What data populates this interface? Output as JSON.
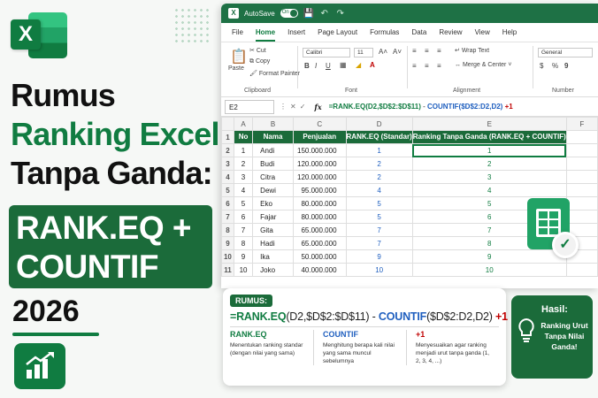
{
  "banner": {
    "title_line1": "Rumus",
    "title_line2": "Ranking Excel",
    "title_line3": "Tanpa Ganda:",
    "box_line1": "RANK.EQ +",
    "box_line2": "COUNTIF",
    "year": "2026"
  },
  "window": {
    "autosave": "AutoSave",
    "toggle": "On",
    "tabs": [
      "File",
      "Home",
      "Insert",
      "Page Layout",
      "Formulas",
      "Data",
      "Review",
      "View",
      "Help"
    ],
    "active_tab": "Home",
    "ribbon": {
      "paste": "Paste",
      "cut": "Cut",
      "copy": "Copy",
      "format_painter": "Format Painter",
      "clipboard": "Clipboard",
      "font_name": "Calibri",
      "font_size": "11",
      "font_group": "Font",
      "wrap_text": "Wrap Text",
      "merge_center": "Merge & Center",
      "alignment": "Alignment",
      "number_format": "General",
      "number": "Number"
    },
    "name_box": "E2",
    "fx": "fx",
    "formula": {
      "part1": "=RANK.EQ(D2,$D$2:$D$11)",
      "dash": " - ",
      "part2": "COUNTIF($D$2:D2,D2)",
      "part3": " +1"
    }
  },
  "sheet": {
    "columns": [
      "A",
      "B",
      "C",
      "D",
      "E",
      "F"
    ],
    "headers": {
      "no": "No",
      "nama": "Nama",
      "penjualan": "Penjualan",
      "rank_std": "RANK.EQ (Standar)",
      "rank_unique": "Ranking Tanpa Ganda (RANK.EQ + COUNTIF)"
    },
    "rows": [
      {
        "row": "2",
        "no": "1",
        "nama": "Andi",
        "penjualan": "150.000.000",
        "rank": "1",
        "unique": "1"
      },
      {
        "row": "3",
        "no": "2",
        "nama": "Budi",
        "penjualan": "120.000.000",
        "rank": "2",
        "unique": "2"
      },
      {
        "row": "4",
        "no": "3",
        "nama": "Citra",
        "penjualan": "120.000.000",
        "rank": "2",
        "unique": "3"
      },
      {
        "row": "5",
        "no": "4",
        "nama": "Dewi",
        "penjualan": "95.000.000",
        "rank": "4",
        "unique": "4"
      },
      {
        "row": "6",
        "no": "5",
        "nama": "Eko",
        "penjualan": "80.000.000",
        "rank": "5",
        "unique": "5"
      },
      {
        "row": "7",
        "no": "6",
        "nama": "Fajar",
        "penjualan": "80.000.000",
        "rank": "5",
        "unique": "6"
      },
      {
        "row": "8",
        "no": "7",
        "nama": "Gita",
        "penjualan": "65.000.000",
        "rank": "7",
        "unique": "7"
      },
      {
        "row": "9",
        "no": "8",
        "nama": "Hadi",
        "penjualan": "65.000.000",
        "rank": "7",
        "unique": "8"
      },
      {
        "row": "10",
        "no": "9",
        "nama": "Ika",
        "penjualan": "50.000.000",
        "rank": "9",
        "unique": "9"
      },
      {
        "row": "11",
        "no": "10",
        "nama": "Joko",
        "penjualan": "40.000.000",
        "rank": "10",
        "unique": "10"
      }
    ]
  },
  "card": {
    "tag": "RUMUS:",
    "f_rank": "=RANK.EQ",
    "f_rank_args": "(D2,$D$2:$D$11)",
    "f_dash": " - ",
    "f_count": "COUNTIF",
    "f_count_args": "($D$2:D2,D2)",
    "f_plus": " +1",
    "cols": [
      {
        "head": "RANK.EQ",
        "desc": "Menentukan ranking standar (dengan nilai yang sama)"
      },
      {
        "head": "COUNTIF",
        "desc": "Menghitung berapa kali nilai yang sama muncul sebelumnya"
      },
      {
        "head": "+1",
        "desc": "Menyesuaikan agar ranking menjadi urut tanpa ganda (1, 2, 3, 4, ...)"
      }
    ]
  },
  "hasil": {
    "title": "Hasil:",
    "text": "Ranking Urut Tanpa Nilai Ganda!"
  },
  "colors": {
    "excel_green": "#107c41",
    "dark_green": "#1b6b3a",
    "blue": "#1f5fbf",
    "red": "#c00000"
  }
}
